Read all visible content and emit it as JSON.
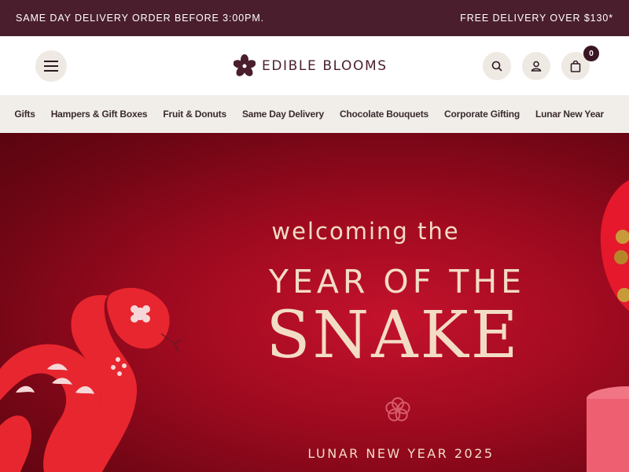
{
  "announcement": {
    "left": "SAME DAY DELIVERY ORDER BEFORE 3:00PM.",
    "right": "FREE DELIVERY OVER $130*"
  },
  "header": {
    "brand": "EDIBLE BLOOMS",
    "cart_count": "0",
    "icons": [
      "hamburger-menu-icon",
      "search-icon",
      "account-icon",
      "shopping-bag-icon"
    ]
  },
  "nav": {
    "items": [
      "Gifts",
      "Hampers & Gift Boxes",
      "Fruit & Donuts",
      "Same Day Delivery",
      "Chocolate Bouquets",
      "Corporate Gifting",
      "Lunar New Year"
    ]
  },
  "hero": {
    "line1": "welcoming the",
    "line2": "YEAR OF THE",
    "line3": "SNAKE",
    "line4": "LUNAR NEW YEAR 2025"
  },
  "colors": {
    "topbar": "#4a1e2c",
    "brand": "#4a1e2c",
    "nav_bg": "#f1eeea",
    "hero_red": "#9d0a1f",
    "hero_text": "#f3dcc6"
  }
}
